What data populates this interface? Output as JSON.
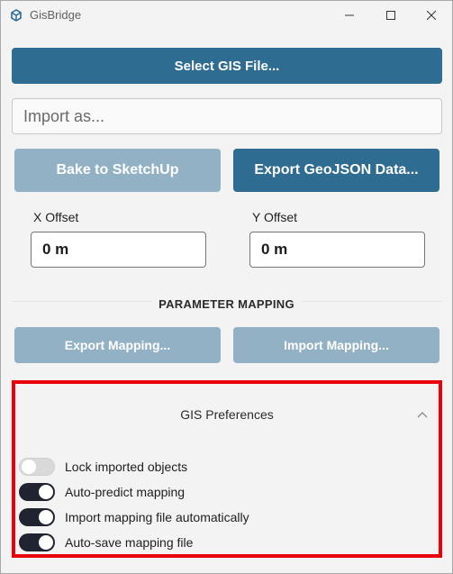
{
  "window": {
    "title": "GisBridge"
  },
  "actions": {
    "select_file": "Select GIS File...",
    "import_as_placeholder": "Import as...",
    "bake": "Bake to SketchUp",
    "export_geojson": "Export GeoJSON Data..."
  },
  "offsets": {
    "x_label": "X Offset",
    "x_value": "0 m",
    "y_label": "Y Offset",
    "y_value": "0 m"
  },
  "mapping": {
    "section_title": "PARAMETER MAPPING",
    "export_label": "Export Mapping...",
    "import_label": "Import Mapping..."
  },
  "preferences": {
    "title": "GIS Preferences",
    "expanded": true,
    "items": [
      {
        "label": "Lock imported objects",
        "enabled": false
      },
      {
        "label": "Auto-predict mapping",
        "enabled": true
      },
      {
        "label": "Import mapping file automatically",
        "enabled": true
      },
      {
        "label": "Auto-save mapping file",
        "enabled": true
      }
    ]
  },
  "colors": {
    "primary": "#2f6c92",
    "primary_disabled": "#93b1c4",
    "highlight_border": "#e8000b",
    "toggle_on": "#1f2430",
    "toggle_off": "#d9d9d9"
  },
  "icons": {
    "app": "sketchup-logo-icon",
    "minimize": "minimize-icon",
    "maximize": "maximize-icon",
    "close": "close-icon",
    "collapse": "chevron-up-icon"
  }
}
